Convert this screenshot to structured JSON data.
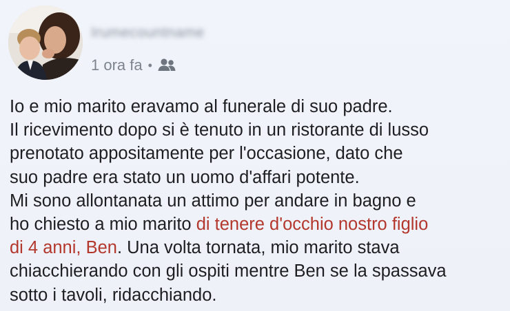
{
  "post": {
    "author_name": "Irumecountname",
    "timestamp": "1 ora fa",
    "separator": "•",
    "audience_icon": "friends-icon",
    "colors": {
      "background": "#eef2f8",
      "text": "#1c1e21",
      "meta": "#7d848e",
      "highlight": "#b3372c"
    },
    "lines": [
      "Io e mio marito eravamo al funerale di suo padre.",
      "Il ricevimento dopo si è tenuto in un ristorante di lusso",
      "prenotato appositamente per l'occasione, dato che",
      "suo padre era stato un uomo d'affari potente.",
      "Mi sono allontanata un attimo per andare in bagno e"
    ],
    "line6_prefix": "ho chiesto a mio marito ",
    "line6_highlight": "di tenere d'occhio nostro figlio",
    "line7_highlight": "di 4 anni, Ben",
    "line7_suffix": ". Una volta tornata, mio marito stava",
    "line8": "chiacchierando con gli ospiti mentre Ben se la spassava",
    "line9": "sotto i tavoli, ridacchiando."
  }
}
